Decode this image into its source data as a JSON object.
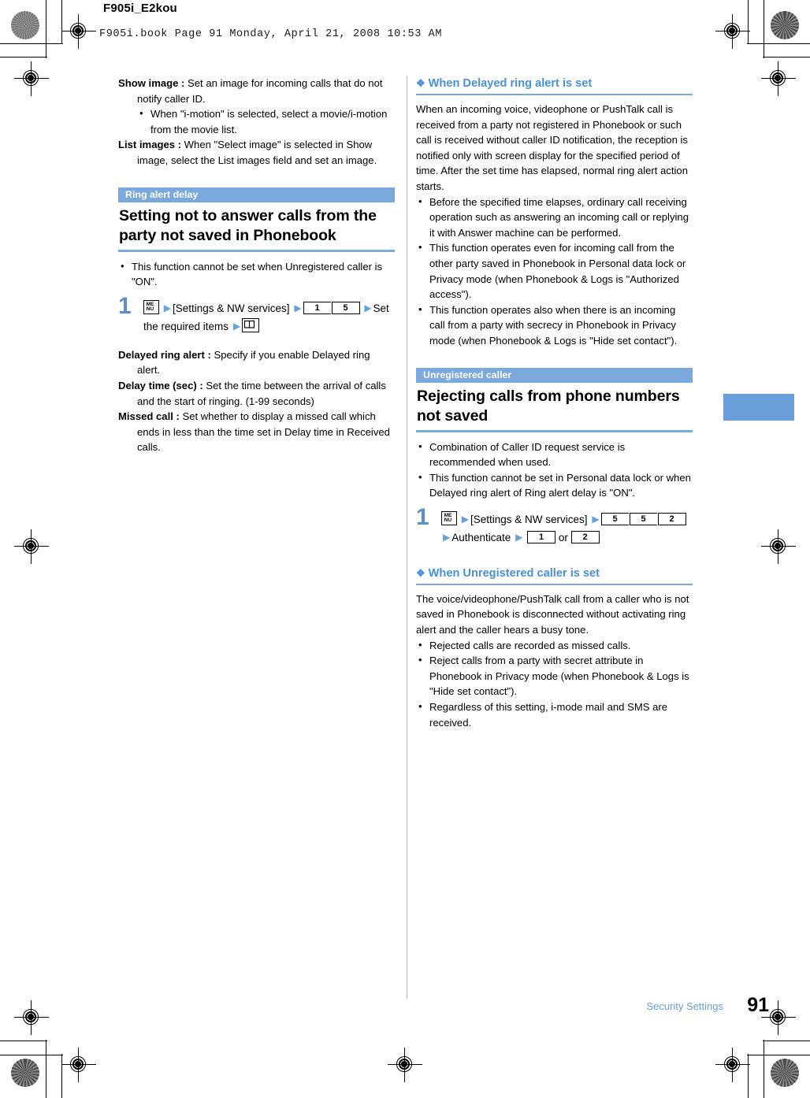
{
  "header": {
    "doc_id": "F905i_E2kou",
    "booknote": "F905i.book  Page 91  Monday, April 21, 2008  10:53 AM"
  },
  "footer": {
    "chapter": "Security Settings",
    "page_number": "91"
  },
  "left_column": {
    "definitions_top": [
      {
        "term": "Show image :",
        "text": " Set an image for incoming calls that do not notify caller ID."
      }
    ],
    "sub_bullets_top": [
      "When \"i-motion\" is selected, select a movie/i-motion from the movie list."
    ],
    "definitions_top2": [
      {
        "term": "List images :",
        "text": " When \"Select image\" is selected in Show image, select the List images field and set an image."
      }
    ],
    "section": {
      "tag": "Ring alert delay",
      "title": "Setting not to answer calls from the party not saved in Phonebook"
    },
    "notes": [
      "This function cannot be set when Unregistered caller is \"ON\"."
    ],
    "step": {
      "number": "1",
      "menu_icon": "menu-key-icon",
      "bracket_label": "[Settings & NW services]",
      "keys_1": [
        "1",
        "5"
      ],
      "mid_label": "Set the required items",
      "select_icon": "book-key-icon"
    },
    "definitions_step": [
      {
        "term": "Delayed ring alert :",
        "text": " Specify if you enable Delayed ring alert."
      },
      {
        "term": "Delay time (sec) :",
        "text": " Set the time between the arrival of calls and the start of ringing. (1-99 seconds)"
      },
      {
        "term": "Missed call :",
        "text": " Set whether to display a missed call which ends in less than the time set in Delay time in Received calls."
      }
    ]
  },
  "right_column": {
    "sub_head_1": "When Delayed ring alert is set",
    "paragraph_1": "When an incoming voice, videophone or PushTalk call is received from a party not registered in Phonebook or such call is received without caller ID notification, the reception is notified only with screen display for the specified period of time. After the set time has elapsed, normal ring alert action starts.",
    "bullets_1": [
      "Before the specified time elapses, ordinary call receiving operation such as answering an incoming call or replying it with Answer machine can be performed.",
      "This function operates even for incoming call from the other party saved in Phonebook in Personal data lock or Privacy mode (when Phonebook & Logs is \"Authorized access\").",
      "This function operates also when there is an incoming call from a party with secrecy in Phonebook in Privacy mode (when Phonebook & Logs is \"Hide set contact\")."
    ],
    "section": {
      "tag": "Unregistered caller",
      "title": "Rejecting calls from phone numbers not saved"
    },
    "notes": [
      "Combination of Caller ID request service is recommended when used.",
      "This function cannot be set in Personal data lock or when Delayed ring alert of Ring alert delay is \"ON\"."
    ],
    "step": {
      "number": "1",
      "menu_icon": "menu-key-icon",
      "bracket_label": "[Settings & NW services]",
      "keys_1": [
        "5",
        "5",
        "2"
      ],
      "mid_label": "Authenticate",
      "key_a": "1",
      "or_label": "or",
      "key_b": "2"
    },
    "sub_head_2": "When Unregistered caller is set",
    "paragraph_2": "The voice/videophone/PushTalk call from a caller who is not saved in Phonebook is disconnected without activating ring alert and the caller hears a busy tone.",
    "bullets_2": [
      "Rejected calls are recorded as missed calls.",
      "Reject calls from a party with secret attribute in Phonebook in Privacy mode (when Phonebook & Logs is \"Hide set contact\").",
      "Regardless of this setting, i-mode mail and SMS are received."
    ]
  },
  "colors": {
    "accent_blue": "#7aa9dd",
    "link_blue": "#4a90d9",
    "tab_blue": "#6a9edb"
  }
}
